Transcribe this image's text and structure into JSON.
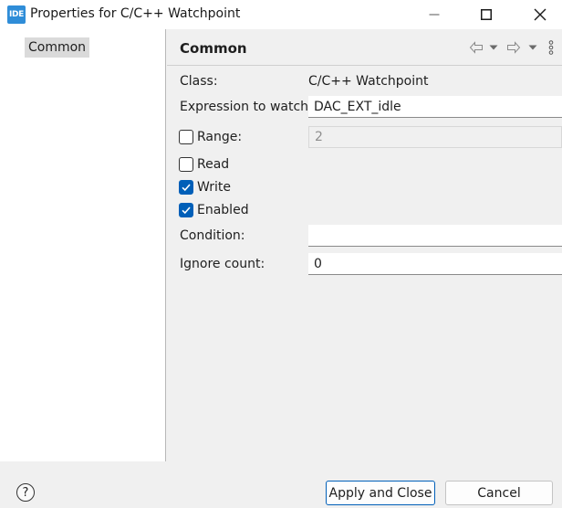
{
  "window": {
    "app_icon_text": "IDE",
    "title": "Properties for C/C++ Watchpoint",
    "icons": [
      "minimize-icon",
      "maximize-icon",
      "close-icon"
    ]
  },
  "tree": {
    "items": [
      {
        "label": "Common",
        "selected": true
      }
    ]
  },
  "page": {
    "title": "Common",
    "nav_icons": [
      "back-arrow-icon",
      "back-dropdown-icon",
      "forward-arrow-icon",
      "forward-dropdown-icon",
      "more-menu-icon"
    ],
    "class_label": "Class:",
    "class_value": "C/C++ Watchpoint",
    "expression_label": "Expression to watch:",
    "expression_value": "DAC_EXT_idle",
    "range": {
      "label": "Range:",
      "checked": false,
      "value": "2",
      "enabled": false
    },
    "read": {
      "label": "Read",
      "checked": false
    },
    "write": {
      "label": "Write",
      "checked": true
    },
    "enabled": {
      "label": "Enabled",
      "checked": true
    },
    "condition_label": "Condition:",
    "condition_value": "",
    "ignore_label": "Ignore count:",
    "ignore_value": "0"
  },
  "footer": {
    "help_icon": "help-icon",
    "help_glyph": "?",
    "apply_close_label": "Apply and Close",
    "cancel_label": "Cancel"
  },
  "colors": {
    "accent": "#005fb8",
    "app_icon": "#2f8dd8",
    "background": "#f0f0f0"
  }
}
